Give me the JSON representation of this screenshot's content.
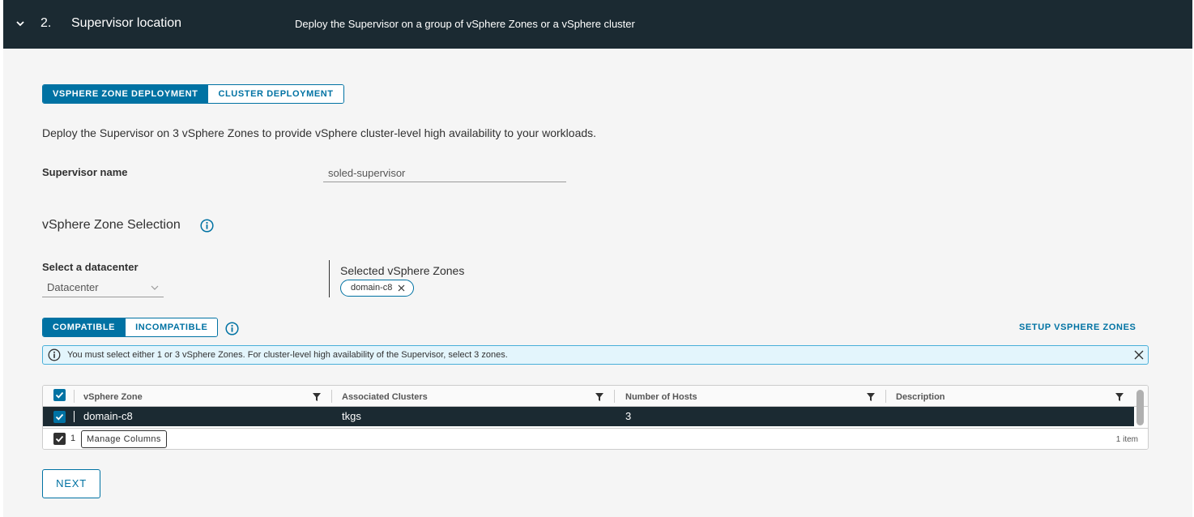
{
  "header": {
    "step_number": "2.",
    "title": "Supervisor location",
    "subtitle": "Deploy the Supervisor on a group of vSphere Zones or a vSphere cluster"
  },
  "deployment_tabs": [
    {
      "label": "VSPHERE ZONE DEPLOYMENT",
      "active": true
    },
    {
      "label": "CLUSTER DEPLOYMENT",
      "active": false
    }
  ],
  "intro_text": "Deploy the Supervisor on 3 vSphere Zones to provide vSphere cluster-level high availability to your workloads.",
  "supervisor_name": {
    "label": "Supervisor name",
    "value": "soled-supervisor"
  },
  "zone_selection": {
    "title": "vSphere Zone Selection",
    "datacenter_label": "Select a datacenter",
    "datacenter_value": "Datacenter",
    "selected_label": "Selected vSphere Zones",
    "selected_chips": [
      "domain-c8"
    ]
  },
  "filter_tabs": [
    {
      "label": "COMPATIBLE",
      "active": true
    },
    {
      "label": "INCOMPATIBLE",
      "active": false
    }
  ],
  "setup_link": "SETUP VSPHERE ZONES",
  "alert": {
    "message": "You must select either 1 or 3 vSphere Zones. For cluster-level high availability of the Supervisor, select 3 zones."
  },
  "table": {
    "columns": [
      "vSphere Zone",
      "Associated Clusters",
      "Number of Hosts",
      "Description"
    ],
    "rows": [
      {
        "zone": "domain-c8",
        "clusters": "tkgs",
        "hosts": "3",
        "description": "",
        "selected": true
      }
    ],
    "footer": {
      "selected_count": "1",
      "manage_columns": "Manage Columns",
      "item_count": "1 item"
    }
  },
  "next_button": "NEXT",
  "colors": {
    "header_bg": "#1b2a32",
    "accent": "#0072a3",
    "alert_bg": "#e3f5fc",
    "alert_border": "#49afd9",
    "page_bg": "#f5f5f5"
  }
}
